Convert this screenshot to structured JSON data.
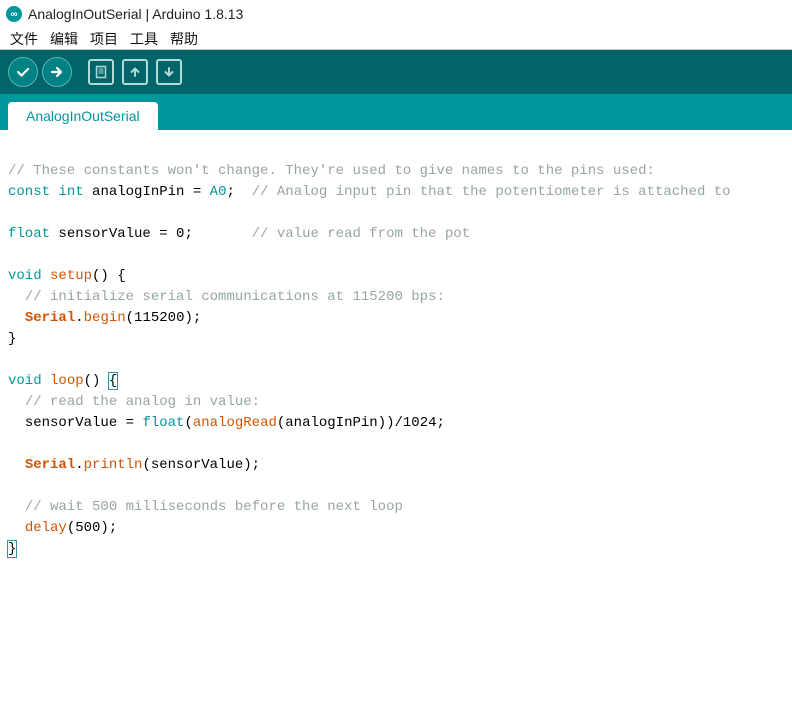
{
  "window": {
    "title": "AnalogInOutSerial | Arduino 1.8.13",
    "logo_letter": "∞"
  },
  "menubar": {
    "items": [
      "文件",
      "编辑",
      "项目",
      "工具",
      "帮助"
    ]
  },
  "toolbar": {
    "verify": "verify",
    "upload": "upload",
    "new": "new",
    "open": "open",
    "save": "save"
  },
  "tabs": {
    "items": [
      "AnalogInOutSerial"
    ]
  },
  "editor": {
    "lines": [
      {
        "indent": 0,
        "tokens": []
      },
      {
        "indent": 0,
        "tokens": [
          {
            "t": "cm",
            "v": "// These constants won't change. They're used to give names to the pins used:"
          }
        ]
      },
      {
        "indent": 0,
        "tokens": [
          {
            "t": "kw",
            "v": "const"
          },
          {
            "t": "txt",
            "v": " "
          },
          {
            "t": "kw",
            "v": "int"
          },
          {
            "t": "txt",
            "v": " analogInPin = "
          },
          {
            "t": "const",
            "v": "A0"
          },
          {
            "t": "txt",
            "v": ";  "
          },
          {
            "t": "cm",
            "v": "// Analog input pin that the potentiometer is attached to"
          }
        ]
      },
      {
        "indent": 0,
        "tokens": []
      },
      {
        "indent": 0,
        "tokens": [
          {
            "t": "kw",
            "v": "float"
          },
          {
            "t": "txt",
            "v": " sensorValue = 0;       "
          },
          {
            "t": "cm",
            "v": "// value read from the pot"
          }
        ]
      },
      {
        "indent": 0,
        "tokens": []
      },
      {
        "indent": 0,
        "tokens": [
          {
            "t": "kw",
            "v": "void"
          },
          {
            "t": "txt",
            "v": " "
          },
          {
            "t": "fn",
            "v": "setup"
          },
          {
            "t": "txt",
            "v": "() {"
          }
        ]
      },
      {
        "indent": 1,
        "tokens": [
          {
            "t": "cm",
            "v": "// initialize serial communications at 115200 bps:"
          }
        ]
      },
      {
        "indent": 1,
        "tokens": [
          {
            "t": "cls",
            "v": "Serial"
          },
          {
            "t": "txt",
            "v": "."
          },
          {
            "t": "fn",
            "v": "begin"
          },
          {
            "t": "txt",
            "v": "(115200);"
          }
        ]
      },
      {
        "indent": 0,
        "tokens": [
          {
            "t": "txt",
            "v": "}"
          }
        ]
      },
      {
        "indent": 0,
        "tokens": []
      },
      {
        "indent": 0,
        "tokens": [
          {
            "t": "kw",
            "v": "void"
          },
          {
            "t": "txt",
            "v": " "
          },
          {
            "t": "fn",
            "v": "loop"
          },
          {
            "t": "txt",
            "v": "() "
          },
          {
            "t": "brh",
            "v": "{"
          }
        ]
      },
      {
        "indent": 1,
        "tokens": [
          {
            "t": "cm",
            "v": "// read the analog in value:"
          }
        ]
      },
      {
        "indent": 1,
        "tokens": [
          {
            "t": "txt",
            "v": "sensorValue = "
          },
          {
            "t": "kw",
            "v": "float"
          },
          {
            "t": "txt",
            "v": "("
          },
          {
            "t": "fn",
            "v": "analogRead"
          },
          {
            "t": "txt",
            "v": "(analogInPin))/1024;"
          }
        ]
      },
      {
        "indent": 0,
        "tokens": []
      },
      {
        "indent": 1,
        "tokens": [
          {
            "t": "cls",
            "v": "Serial"
          },
          {
            "t": "txt",
            "v": "."
          },
          {
            "t": "fn",
            "v": "println"
          },
          {
            "t": "txt",
            "v": "(sensorValue);"
          }
        ]
      },
      {
        "indent": 0,
        "tokens": []
      },
      {
        "indent": 1,
        "tokens": [
          {
            "t": "cm",
            "v": "// wait 500 milliseconds before the next loop"
          }
        ]
      },
      {
        "indent": 1,
        "tokens": [
          {
            "t": "fn",
            "v": "delay"
          },
          {
            "t": "txt",
            "v": "(500);"
          }
        ]
      },
      {
        "indent": 0,
        "tokens": [
          {
            "t": "brh",
            "v": "}"
          }
        ],
        "cursor": true
      }
    ]
  }
}
